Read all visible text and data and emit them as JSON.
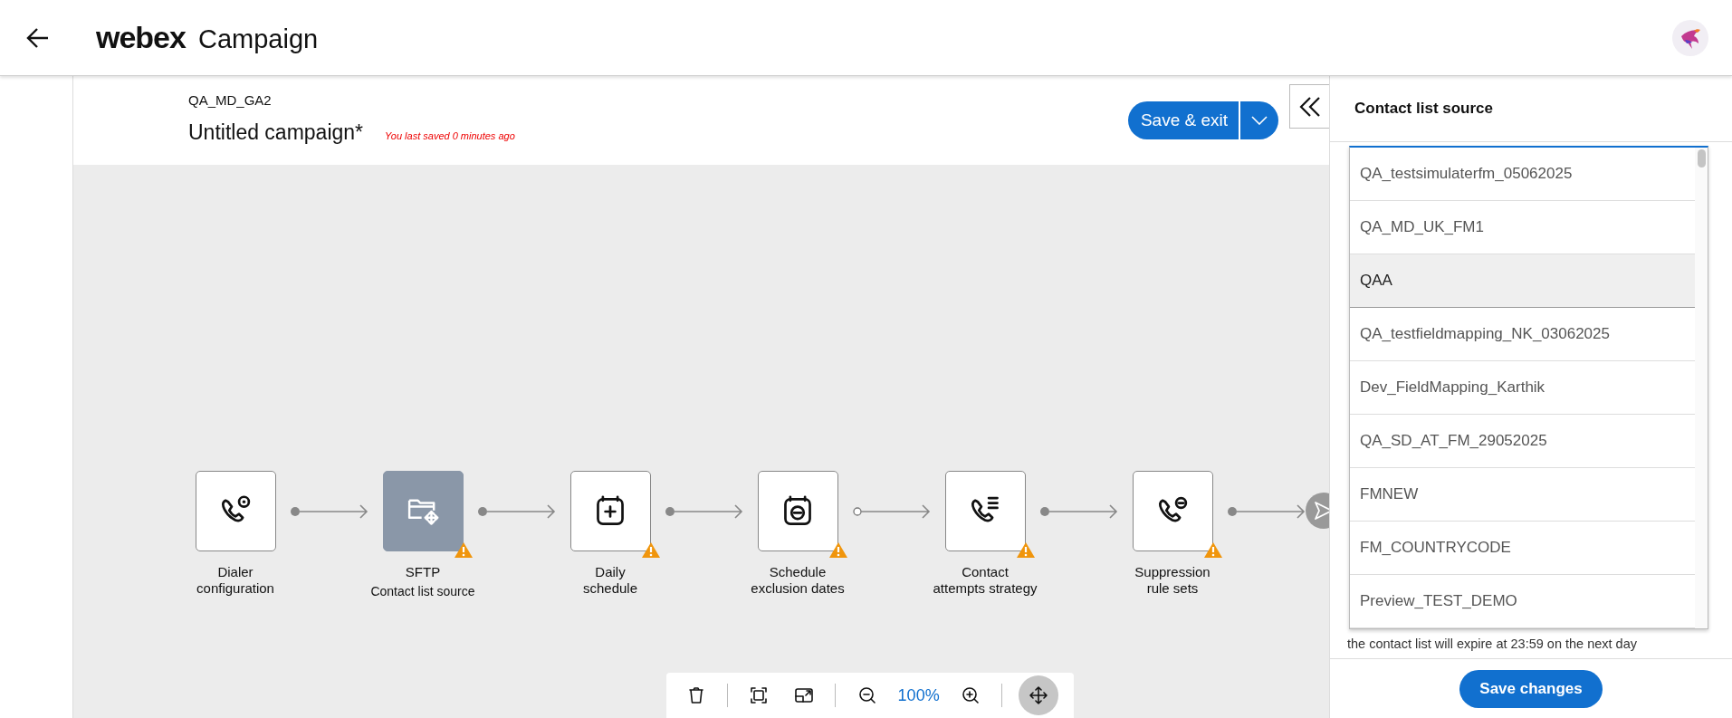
{
  "header": {
    "logo": "webex",
    "title": "Campaign"
  },
  "campaign": {
    "code": "QA_MD_GA2",
    "name": "Untitled campaign*",
    "saved_note": "You last saved 0 minutes ago",
    "save_button": "Save & exit"
  },
  "flow": {
    "nodes": [
      {
        "kind": "dialer",
        "label": "Dialer\nconfiguration",
        "selected": false,
        "warning": false,
        "link_open": false
      },
      {
        "kind": "sftp",
        "label": "SFTP",
        "sublabel": "Contact list source",
        "selected": true,
        "warning": true,
        "link_open": false
      },
      {
        "kind": "daily",
        "label": "Daily\nschedule",
        "selected": false,
        "warning": true,
        "link_open": false
      },
      {
        "kind": "exclusion",
        "label": "Schedule\nexclusion dates",
        "selected": false,
        "warning": true,
        "link_open": true
      },
      {
        "kind": "attempts",
        "label": "Contact\nattempts strategy",
        "selected": false,
        "warning": true,
        "link_open": false
      },
      {
        "kind": "suppression",
        "label": "Suppression\nrule sets",
        "selected": false,
        "warning": true,
        "link_open": false
      }
    ]
  },
  "toolbar": {
    "zoom": "100%",
    "pan_selected": true
  },
  "panel": {
    "title": "Contact list source",
    "options": [
      {
        "label": "QA_testsimulaterfm_05062025",
        "selected": false
      },
      {
        "label": "QA_MD_UK_FM1",
        "selected": false
      },
      {
        "label": "QAA",
        "selected": true
      },
      {
        "label": "QA_testfieldmapping_NK_03062025",
        "selected": false
      },
      {
        "label": "Dev_FieldMapping_Karthik",
        "selected": false
      },
      {
        "label": "QA_SD_AT_FM_29052025",
        "selected": false
      },
      {
        "label": "FMNEW",
        "selected": false
      },
      {
        "label": "FM_COUNTRYCODE",
        "selected": false
      },
      {
        "label": "Preview_TEST_DEMO",
        "selected": false
      }
    ],
    "note": "the contact list will expire at 23:59 on the next day",
    "save_button": "Save changes"
  }
}
